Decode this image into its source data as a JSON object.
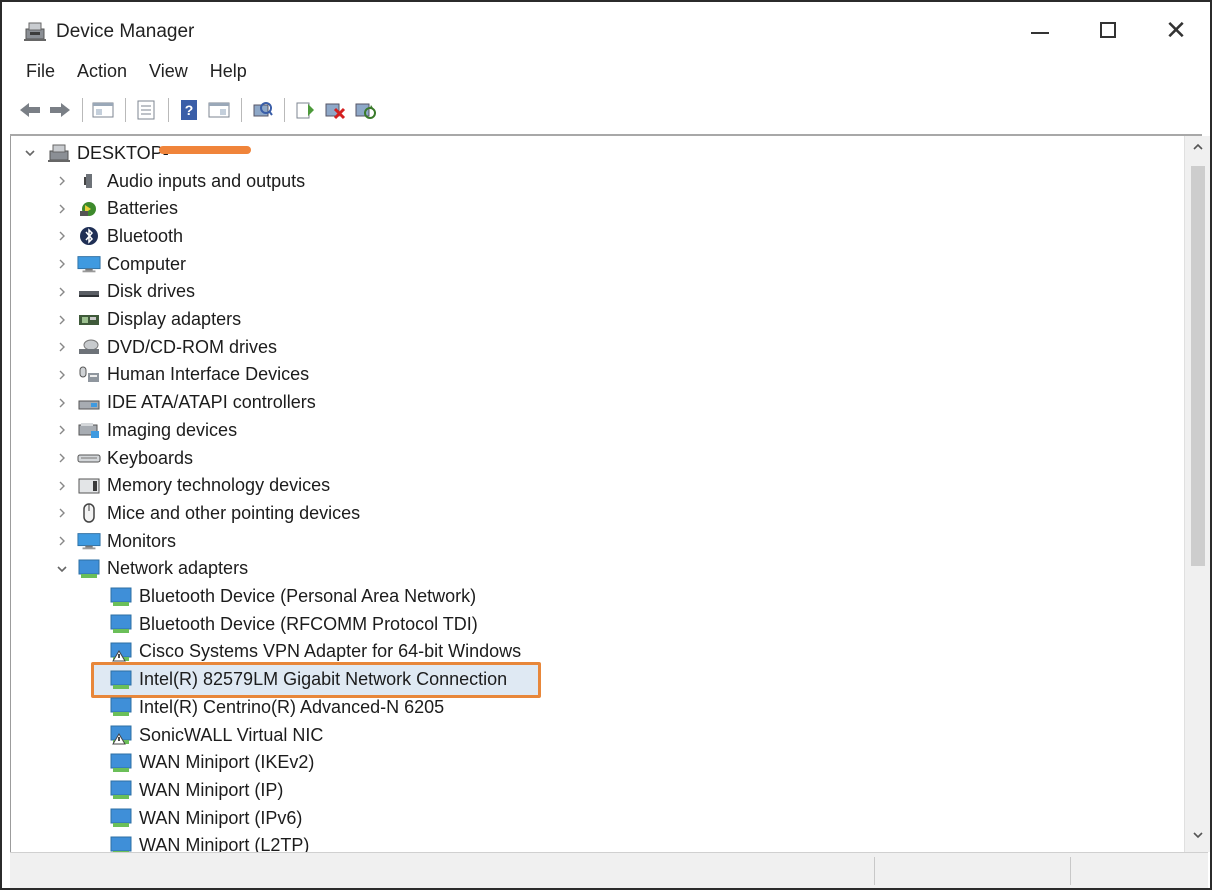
{
  "window": {
    "title": "Device Manager",
    "icon": "device-manager-icon"
  },
  "menu": [
    "File",
    "Action",
    "View",
    "Help"
  ],
  "toolbar": {
    "buttons": [
      "back-arrow-icon",
      "forward-arrow-icon",
      "show-hide-tree-icon",
      "properties-icon",
      "help-icon",
      "action-pane-icon",
      "scan-hardware-icon",
      "update-driver-icon",
      "disable-device-icon",
      "uninstall-device-icon"
    ]
  },
  "tree": {
    "root": "DESKTOP-",
    "categories": [
      {
        "label": "Audio inputs and outputs",
        "icon": "speaker-icon",
        "expanded": false
      },
      {
        "label": "Batteries",
        "icon": "battery-icon",
        "expanded": false
      },
      {
        "label": "Bluetooth",
        "icon": "bluetooth-icon",
        "expanded": false
      },
      {
        "label": "Computer",
        "icon": "monitor-icon",
        "expanded": false
      },
      {
        "label": "Disk drives",
        "icon": "disk-drive-icon",
        "expanded": false
      },
      {
        "label": "Display adapters",
        "icon": "display-adapter-icon",
        "expanded": false
      },
      {
        "label": "DVD/CD-ROM drives",
        "icon": "dvd-drive-icon",
        "expanded": false
      },
      {
        "label": "Human Interface Devices",
        "icon": "hid-icon",
        "expanded": false
      },
      {
        "label": "IDE ATA/ATAPI controllers",
        "icon": "ide-controller-icon",
        "expanded": false
      },
      {
        "label": "Imaging devices",
        "icon": "imaging-device-icon",
        "expanded": false
      },
      {
        "label": "Keyboards",
        "icon": "keyboard-icon",
        "expanded": false
      },
      {
        "label": "Memory technology devices",
        "icon": "memory-device-icon",
        "expanded": false
      },
      {
        "label": "Mice and other pointing devices",
        "icon": "mouse-icon",
        "expanded": false
      },
      {
        "label": "Monitors",
        "icon": "monitor-icon",
        "expanded": false
      },
      {
        "label": "Network adapters",
        "icon": "network-adapter-icon",
        "expanded": true
      }
    ],
    "network_adapters": [
      {
        "label": "Bluetooth Device (Personal Area Network)",
        "icon": "network-adapter-icon"
      },
      {
        "label": "Bluetooth Device (RFCOMM Protocol TDI)",
        "icon": "network-adapter-icon"
      },
      {
        "label": "Cisco Systems VPN Adapter for 64-bit Windows",
        "icon": "network-adapter-warning-icon"
      },
      {
        "label": "Intel(R) 82579LM Gigabit Network Connection",
        "icon": "network-adapter-icon",
        "selected": true
      },
      {
        "label": "Intel(R) Centrino(R) Advanced-N 6205",
        "icon": "network-adapter-icon"
      },
      {
        "label": "SonicWALL Virtual NIC",
        "icon": "network-adapter-warning-icon"
      },
      {
        "label": "WAN Miniport (IKEv2)",
        "icon": "network-adapter-icon"
      },
      {
        "label": "WAN Miniport (IP)",
        "icon": "network-adapter-icon"
      },
      {
        "label": "WAN Miniport (IPv6)",
        "icon": "network-adapter-icon"
      },
      {
        "label": "WAN Miniport (L2TP)",
        "icon": "network-adapter-icon"
      }
    ]
  },
  "colors": {
    "selection_outline": "#e8873a",
    "selection_fill": "#dfe9f3",
    "redaction": "#f0843a",
    "adapter_blue": "#3f8fd8",
    "adapter_green": "#6bbf59"
  }
}
